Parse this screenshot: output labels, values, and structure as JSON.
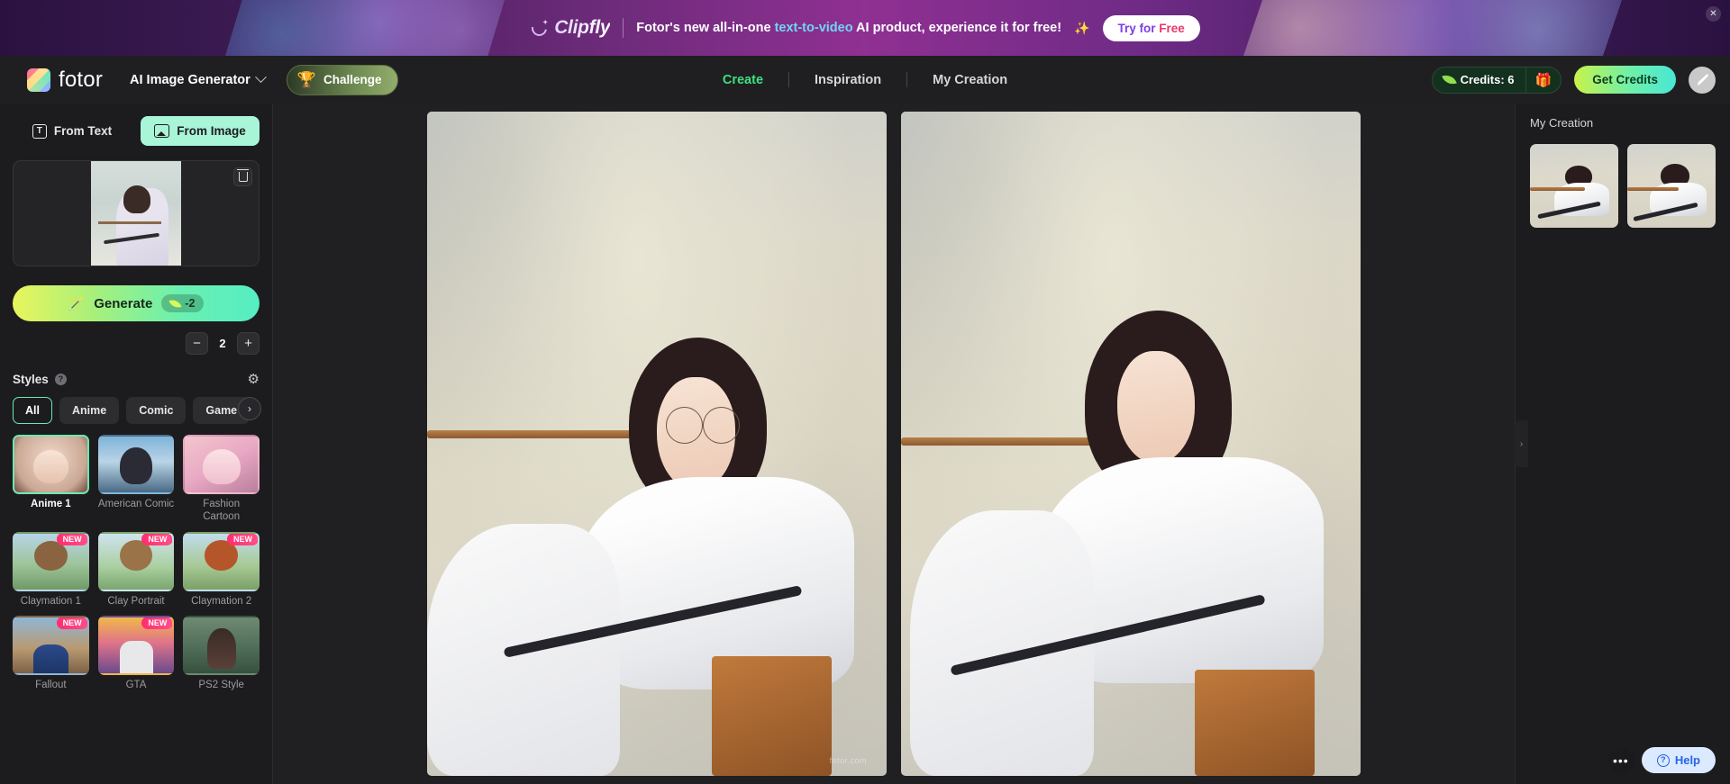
{
  "promo": {
    "brand": "Clipfly",
    "text_before": "Fotor's new all-in-one ",
    "text_highlight": "text-to-video",
    "text_after": " AI product, experience it for free!",
    "sparkle": "✨",
    "cta_part1": "Try for ",
    "cta_part2": "Free",
    "close_icon": "✕"
  },
  "header": {
    "brand_name": "fotor",
    "app_name": "AI Image Generator",
    "challenge_label": "Challenge",
    "trophy_icon": "🏆",
    "nav": [
      {
        "label": "Create",
        "active": true
      },
      {
        "label": "Inspiration",
        "active": false
      },
      {
        "label": "My Creation",
        "active": false
      }
    ],
    "credits_label": "Credits: 6",
    "gift_icon": "🎁",
    "get_credits_label": "Get Credits"
  },
  "left_panel": {
    "tabs": [
      {
        "label": "From Text",
        "active": false
      },
      {
        "label": "From Image",
        "active": true
      }
    ],
    "text_icon_glyph": "T",
    "generate_label": "Generate",
    "generate_cost": "-2",
    "stepper": {
      "minus": "−",
      "value": "2",
      "plus": "+"
    },
    "styles_title": "Styles",
    "help_glyph": "?",
    "gear_glyph": "⚙",
    "next_glyph": "›",
    "categories": [
      {
        "label": "All",
        "active": true
      },
      {
        "label": "Anime",
        "active": false
      },
      {
        "label": "Comic",
        "active": false
      },
      {
        "label": "Game",
        "active": false
      }
    ],
    "styles": [
      {
        "label": "Anime 1",
        "selected": true,
        "badge": null,
        "art": "a-anime1"
      },
      {
        "label": "American Comic",
        "selected": false,
        "badge": null,
        "art": "a-comic"
      },
      {
        "label": "Fashion Cartoon",
        "selected": false,
        "badge": null,
        "art": "a-fashion"
      },
      {
        "label": "Claymation 1",
        "selected": false,
        "badge": "NEW",
        "art": "a-clay1"
      },
      {
        "label": "Clay Portrait",
        "selected": false,
        "badge": "NEW",
        "art": "a-clay2"
      },
      {
        "label": "Claymation 2",
        "selected": false,
        "badge": "NEW",
        "art": "a-clay3"
      },
      {
        "label": "Fallout",
        "selected": false,
        "badge": "NEW",
        "art": "a-fallout"
      },
      {
        "label": "GTA",
        "selected": false,
        "badge": "NEW",
        "art": "a-gta"
      },
      {
        "label": "PS2 Style",
        "selected": false,
        "badge": null,
        "art": "a-ps2"
      }
    ]
  },
  "canvas": {
    "watermark": "fotor.com",
    "results": [
      {
        "alt": "anime illustration result 1"
      },
      {
        "alt": "anime illustration result 2"
      }
    ]
  },
  "right_panel": {
    "title": "My Creation",
    "collapse_glyph": "›",
    "thumbs": [
      {
        "alt": "my creation thumbnail 1"
      },
      {
        "alt": "my creation thumbnail 2"
      }
    ]
  },
  "floating": {
    "dots_glyph": "•••",
    "help_label": "Help",
    "help_glyph": "?"
  },
  "colors": {
    "accent_green": "#3fe07f",
    "mint": "#a8f5d8",
    "pink_badge": "#ff2d6f",
    "help_blue": "#2563eb"
  }
}
